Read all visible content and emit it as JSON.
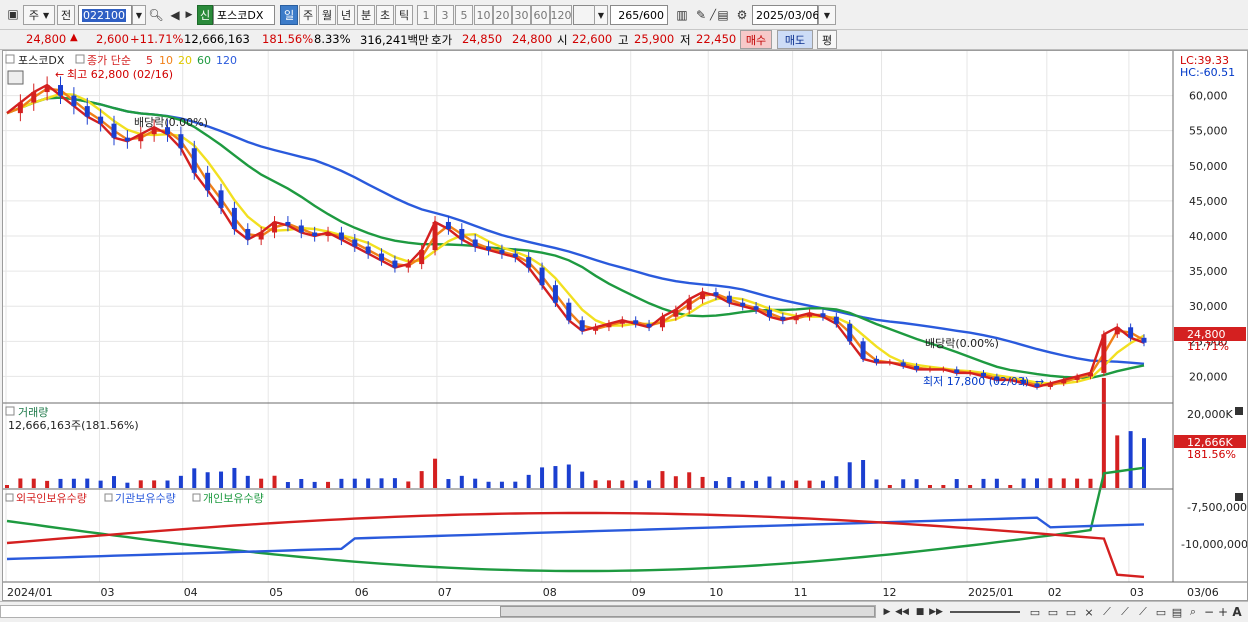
{
  "toolbar": {
    "period_select": "주",
    "prev_label": "전",
    "code": "022100",
    "credit_badge": "신",
    "name": "포스코DX",
    "period_tabs": [
      "일",
      "주",
      "월",
      "년",
      "분",
      "초",
      "틱"
    ],
    "intervals": [
      "1",
      "3",
      "5",
      "10",
      "20",
      "30",
      "60",
      "120"
    ],
    "count": "265",
    "count_max": "/600",
    "date": "2025/03/06"
  },
  "quote": {
    "price": "24,800",
    "change_arrow": "▲",
    "change": "2,600",
    "change_pct": "+11.71%",
    "volume": "12,666,163",
    "volume_pct": "181.56%",
    "turnover_pct": "8.33%",
    "amount": "316,241백만",
    "ask_label": "호가",
    "ask": "24,850",
    "bid": "24,800",
    "open_label": "시",
    "open": "22,600",
    "high_label": "고",
    "high": "25,900",
    "low_label": "저",
    "low": "22,450",
    "buy_button": "매수",
    "sell_button": "매도",
    "eval_button": "평"
  },
  "legend": {
    "name": "포스코DX",
    "ma_label": "종가 단순",
    "ma_periods": [
      "5",
      "10",
      "20",
      "60",
      "120"
    ],
    "ma_colors": [
      "#d42020",
      "#f08018",
      "#f2e020",
      "#1e9a40",
      "#2a5adc"
    ],
    "lc": "LC:39.33",
    "hc": "HC:-60.51"
  },
  "annotations": {
    "high_marker": "최고 62,800 (02/16)",
    "low_marker": "최저 17,800 (02/03)",
    "dividend_1": "배당락(0.00%)",
    "dividend_2": "배당락(0.00%)"
  },
  "price_axis": {
    "ticks": [
      "60,000",
      "55,000",
      "50,000",
      "45,000",
      "40,000",
      "35,000",
      "30,000",
      "25,000",
      "20,000"
    ],
    "current_price": "24,800",
    "current_pct": "11.71%"
  },
  "volume_panel": {
    "title": "거래량",
    "value": "12,666,163주(181.56%)",
    "axis_top": "20,000K",
    "current": "12,666K",
    "current_pct": "181.56%"
  },
  "holdings_panel": {
    "legend": [
      "외국인보유수량",
      "기관보유수량",
      "개인보유수량"
    ],
    "axis": [
      "-7,500,000",
      "-10,000,000"
    ]
  },
  "x_axis": {
    "labels": [
      "2024/01",
      "03",
      "04",
      "05",
      "06",
      "07",
      "08",
      "09",
      "10",
      "11",
      "12",
      "2025/01",
      "02",
      "03",
      "03/06"
    ]
  },
  "chart_data": {
    "type": "line",
    "title": "포스코DX",
    "price_range": [
      16500,
      63500
    ],
    "close_weekly": [
      57500,
      59000,
      60500,
      61500,
      60000,
      58500,
      57000,
      56000,
      54000,
      53500,
      54500,
      55500,
      54500,
      52500,
      49000,
      46500,
      44000,
      41000,
      39500,
      40500,
      42000,
      41500,
      40500,
      40000,
      40500,
      39500,
      38500,
      37500,
      36500,
      35500,
      36000,
      38000,
      42000,
      41000,
      39500,
      38500,
      38000,
      37500,
      37000,
      35500,
      33000,
      30500,
      28000,
      26500,
      27000,
      27500,
      28000,
      27500,
      27000,
      28500,
      29500,
      31000,
      32000,
      31500,
      30500,
      30000,
      29500,
      28500,
      28000,
      28500,
      29000,
      28500,
      27500,
      25000,
      22500,
      22000,
      22000,
      21500,
      21000,
      21000,
      21000,
      20500,
      20500,
      20000,
      19500,
      19500,
      19000,
      18500,
      19000,
      19500,
      20000,
      20500,
      26000,
      27000,
      25500,
      24800
    ],
    "ma_colors": [
      "#d42020",
      "#f08018",
      "#f2e020",
      "#1e9a40",
      "#2a5adc"
    ]
  }
}
